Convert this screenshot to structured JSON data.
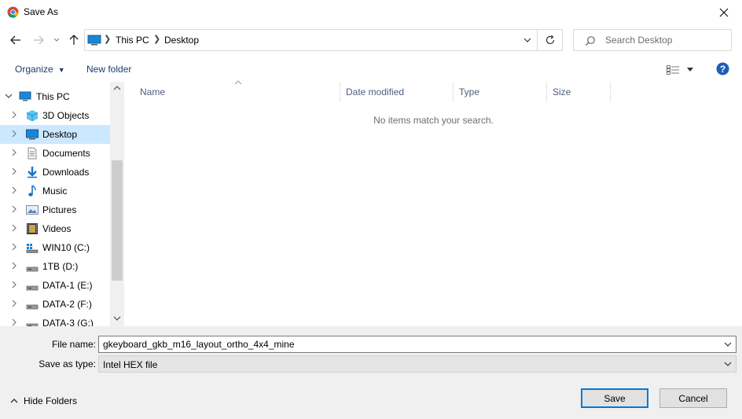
{
  "window": {
    "title": "Save As",
    "icons": {
      "app": "chrome-icon",
      "close": "close-icon"
    }
  },
  "nav": {
    "breadcrumbs": [
      "This PC",
      "Desktop"
    ],
    "search_placeholder": "Search Desktop",
    "icons": {
      "back": "arrow-left-icon",
      "forward": "arrow-right-icon",
      "recent": "chevron-down-icon",
      "up": "arrow-up-icon",
      "refresh": "refresh-icon",
      "search": "search-icon"
    }
  },
  "toolbar": {
    "organize_label": "Organize",
    "new_folder_label": "New folder",
    "icons": {
      "view": "details-view-icon",
      "help": "help-icon"
    }
  },
  "tree": {
    "items": [
      {
        "label": "This PC",
        "icon": "computer-icon"
      },
      {
        "label": "3D Objects",
        "icon": "cube-icon"
      },
      {
        "label": "Desktop",
        "icon": "desktop-icon",
        "selected": true
      },
      {
        "label": "Documents",
        "icon": "document-icon"
      },
      {
        "label": "Downloads",
        "icon": "download-icon"
      },
      {
        "label": "Music",
        "icon": "music-note-icon"
      },
      {
        "label": "Pictures",
        "icon": "picture-icon"
      },
      {
        "label": "Videos",
        "icon": "video-icon"
      },
      {
        "label": "WIN10 (C:)",
        "icon": "system-drive-icon"
      },
      {
        "label": "1TB (D:)",
        "icon": "drive-icon"
      },
      {
        "label": "DATA-1 (E:)",
        "icon": "drive-icon"
      },
      {
        "label": "DATA-2 (F:)",
        "icon": "drive-icon"
      },
      {
        "label": "DATA-3 (G:)",
        "icon": "drive-icon"
      }
    ]
  },
  "files": {
    "columns": [
      "Name",
      "Date modified",
      "Type",
      "Size"
    ],
    "empty_message": "No items match your search."
  },
  "form": {
    "file_name_label": "File name:",
    "file_name_value": "gkeyboard_gkb_m16_layout_ortho_4x4_mine",
    "save_type_label": "Save as type:",
    "save_type_value": "Intel HEX file",
    "hide_folders_label": "Hide Folders",
    "save_label": "Save",
    "cancel_label": "Cancel"
  },
  "colors": {
    "accent": "#0078d7",
    "selection": "#cce8ff",
    "link": "#1e3b6e"
  }
}
